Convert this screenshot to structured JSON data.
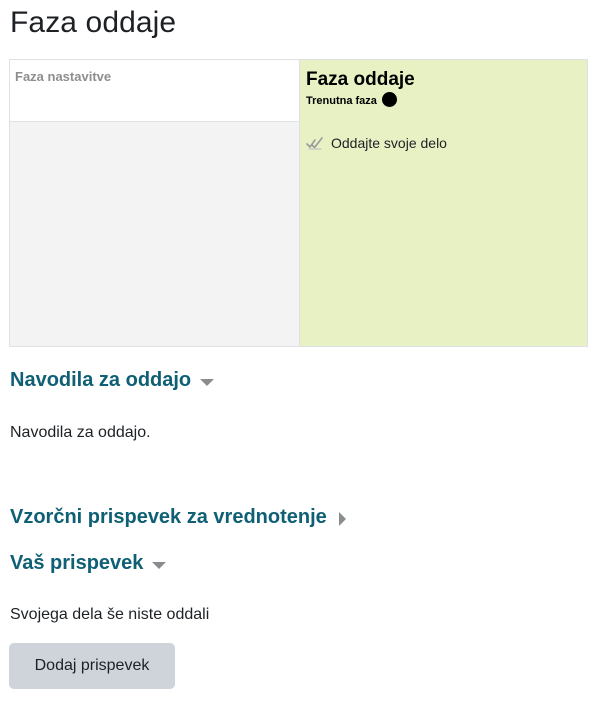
{
  "page": {
    "title": "Faza oddaje"
  },
  "phases": {
    "inactive": {
      "name": "Faza nastavitve"
    },
    "active": {
      "name": "Faza oddaje",
      "current_label": "Trenutna faza",
      "task_label": "Oddajte svoje delo",
      "task_icon": "checkmark-icon",
      "background_color": "#e7f1c3"
    }
  },
  "sections": {
    "instructions": {
      "heading": "Navodila za oddajo",
      "text": "Navodila za oddajo.",
      "state": "expanded"
    },
    "example": {
      "heading": "Vzorčni prispevek za vrednotenje",
      "state": "collapsed"
    },
    "submission": {
      "heading": "Vaš prispevek",
      "status": "Svojega dela še niste oddali",
      "button_label": "Dodaj prispevek",
      "state": "expanded"
    }
  },
  "colors": {
    "heading_accent": "#0f6074",
    "button_bg": "#ced4da"
  }
}
